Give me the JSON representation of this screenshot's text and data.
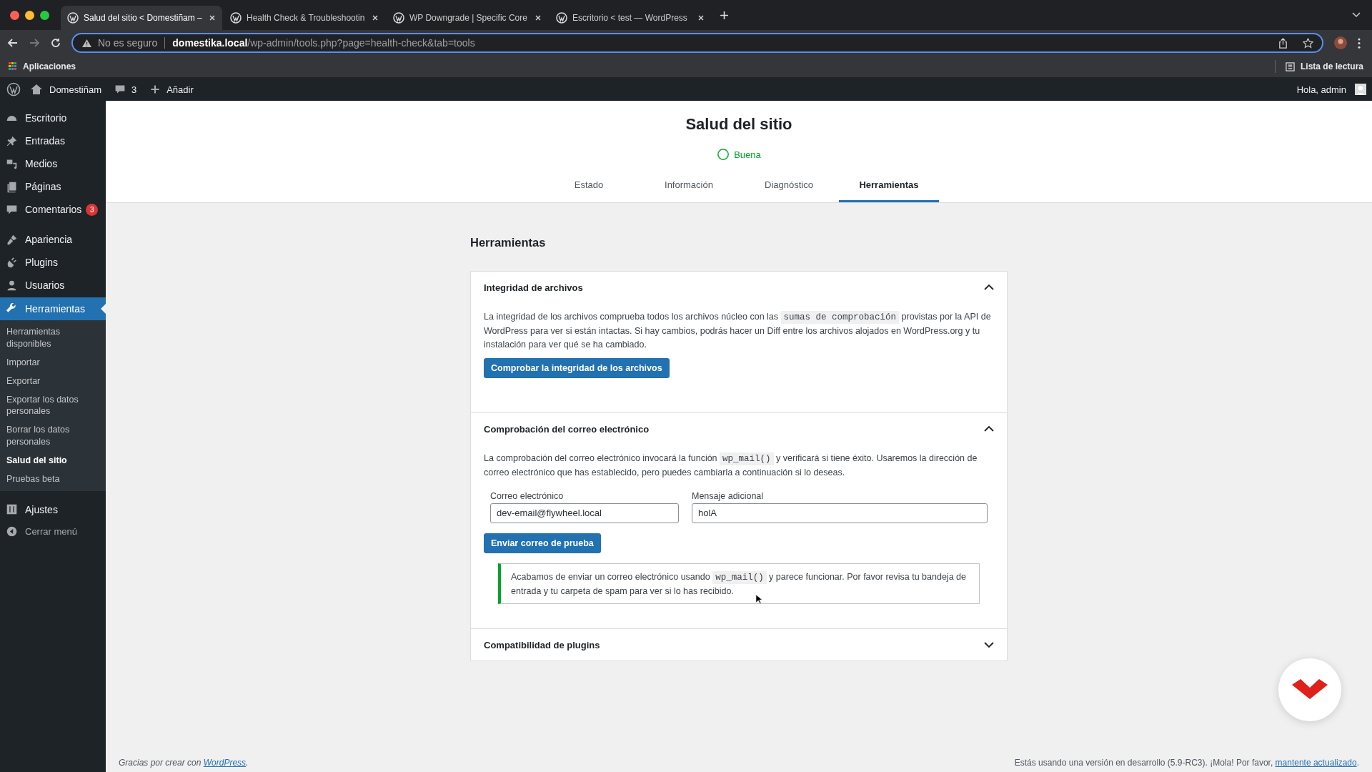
{
  "browser": {
    "tabs": [
      {
        "title": "Salud del sitio < Domestiñam –",
        "selected": true
      },
      {
        "title": "Health Check & Troubleshootin",
        "selected": false
      },
      {
        "title": "WP Downgrade | Specific Core",
        "selected": false
      },
      {
        "title": "Escritorio < test — WordPress",
        "selected": false
      }
    ],
    "address": {
      "warning": "No es seguro",
      "domain": "domestika.local",
      "path": "/wp-admin/tools.php?page=health-check&tab=tools"
    },
    "bookmarks": {
      "apps": "Aplicaciones",
      "reading_list": "Lista de lectura"
    }
  },
  "admin_bar": {
    "site": "Domestiñam",
    "comments": "3",
    "new": "Añadir",
    "greeting": "Hola, admin"
  },
  "sidebar": {
    "items": [
      {
        "label": "Escritorio",
        "selected": false
      },
      {
        "label": "Entradas",
        "selected": false
      },
      {
        "label": "Medios",
        "selected": false
      },
      {
        "label": "Páginas",
        "selected": false
      },
      {
        "label": "Comentarios",
        "badge": "3",
        "selected": false
      },
      {
        "label": "Apariencia",
        "selected": false
      },
      {
        "label": "Plugins",
        "selected": false
      },
      {
        "label": "Usuarios",
        "selected": false
      },
      {
        "label": "Herramientas",
        "selected": true,
        "children": [
          {
            "label": "Herramientas disponibles",
            "selected": false
          },
          {
            "label": "Importar",
            "selected": false
          },
          {
            "label": "Exportar",
            "selected": false
          },
          {
            "label": "Exportar los datos personales",
            "selected": false
          },
          {
            "label": "Borrar los datos personales",
            "selected": false
          },
          {
            "label": "Salud del sitio",
            "selected": true
          },
          {
            "label": "Pruebas beta",
            "selected": false
          }
        ]
      },
      {
        "label": "Ajustes",
        "selected": false
      }
    ],
    "collapse": "Cerrar menú"
  },
  "header": {
    "title": "Salud del sitio",
    "status": "Buena",
    "tabs": [
      {
        "label": "Estado",
        "selected": false
      },
      {
        "label": "Información",
        "selected": false
      },
      {
        "label": "Diagnóstico",
        "selected": false
      },
      {
        "label": "Herramientas",
        "selected": true
      }
    ]
  },
  "section_title": "Herramientas",
  "panels": [
    {
      "title": "Integridad de archivos",
      "expanded": true,
      "description": [
        {
          "kind": "text",
          "text": "La integridad de los archivos comprueba todos los archivos núcleo con las "
        },
        {
          "kind": "code",
          "text": "sumas de comprobación"
        },
        {
          "kind": "text",
          "text": " provistas por la API de WordPress para ver si están intactas. Si hay cambios, podrás hacer un Diff entre los archivos alojados en WordPress.org y tu instalación para ver qué se ha cambiado."
        }
      ],
      "button": "Comprobar la integridad de los archivos"
    },
    {
      "title": "Comprobación del correo electrónico",
      "expanded": true,
      "description": [
        {
          "kind": "text",
          "text": "La comprobación del correo electrónico invocará la función "
        },
        {
          "kind": "code",
          "text": "wp_mail()"
        },
        {
          "kind": "text",
          "text": " y verificará si tiene éxito. Usaremos la dirección de correo electrónico que has establecido, pero puedes cambiarla a continuación si lo deseas."
        }
      ],
      "fields": [
        {
          "label": "Correo electrónico",
          "value": "dev-email@flywheel.local"
        },
        {
          "label": "Mensaje adicional",
          "value": "holA"
        }
      ],
      "button": "Enviar correo de prueba",
      "notice": [
        {
          "kind": "text",
          "text": "Acabamos de enviar un correo electrónico usando "
        },
        {
          "kind": "code",
          "text": "wp_mail()"
        },
        {
          "kind": "text",
          "text": " y parece funcionar. Por favor revisa tu bandeja de entrada y tu carpeta de spam para ver si lo has recibido."
        }
      ]
    },
    {
      "title": "Compatibilidad de plugins",
      "expanded": false
    }
  ],
  "footer": {
    "left": "Gracias por crear con ",
    "left_link": "WordPress",
    "left_end": ".",
    "right": "Estás usando una versión en desarrollo (5.9-RC3). ¡Mola! Por favor, ",
    "right_link": "mantente actualizado",
    "right_end": "."
  }
}
